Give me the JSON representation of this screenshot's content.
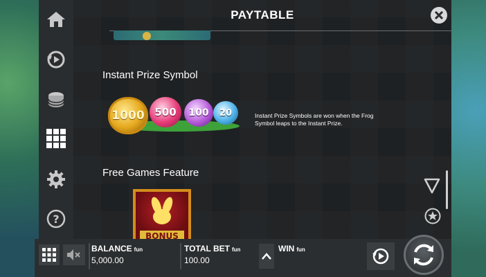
{
  "header": {
    "title": "PAYTABLE"
  },
  "sections": {
    "instant_prize": {
      "heading": "Instant Prize Symbol",
      "coins": [
        "1000",
        "500",
        "100",
        "20"
      ],
      "description": "Instant Prize Symbols are won when the Frog Symbol leaps to the Instant Prize."
    },
    "free_games": {
      "heading": "Free Games Feature",
      "symbol_label": "BONUS"
    }
  },
  "sidebar": {
    "items": [
      {
        "icon": "home-icon"
      },
      {
        "icon": "history-icon"
      },
      {
        "icon": "coins-icon"
      },
      {
        "icon": "paytable-grid-icon"
      },
      {
        "icon": "gear-icon"
      },
      {
        "icon": "help-icon"
      }
    ]
  },
  "bottom_bar": {
    "balance_label": "BALANCE",
    "balance_currency": "fun",
    "balance_value": "5,000.00",
    "total_bet_label": "TOTAL BET",
    "total_bet_currency": "fun",
    "total_bet_value": "100.00",
    "win_label": "WIN",
    "win_currency": "fun"
  },
  "colors": {
    "panel": "#232628",
    "sidebar": "#2a2d2f",
    "text": "#ffffff",
    "gold": "#d48d1c"
  }
}
